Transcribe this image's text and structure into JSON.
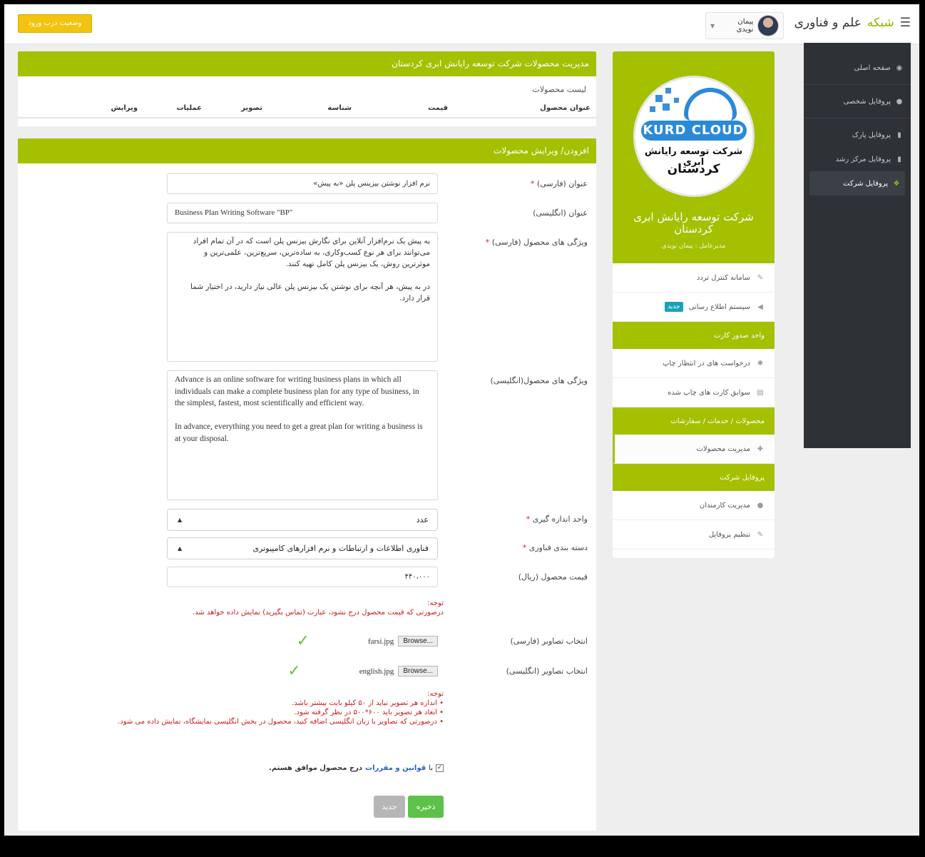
{
  "topbar": {
    "brand_prefix": "شبکه",
    "brand_suffix": "علم و فناوری",
    "user_name": "پیمان نویدی",
    "door_button": "وضعیت درب ورود"
  },
  "dark_sidebar": {
    "items": [
      {
        "label": "صفحه اصلی",
        "icon": "dashboard-icon"
      },
      {
        "label": "پروفایل شخصی",
        "icon": "user-icon"
      },
      {
        "label": "پروفایل پارک",
        "icon": "building-icon"
      },
      {
        "label": "پروفایل مرکز رشد",
        "icon": "building-icon"
      },
      {
        "label": "پروفایل شرکت",
        "icon": "cubes-icon"
      }
    ]
  },
  "profile": {
    "logo_word": "KURD CLOUD",
    "logo_fa_line1": "شرکت توسعه رایانش ابری",
    "logo_fa_line2": "کردستان",
    "company_name": "شرکت توسعه رایانش ابری کردستان",
    "ceo": "مدیرعامل : پیمان نویدی",
    "rows": {
      "access": "سامانه کنترل تردد",
      "notify": "سیستم اطلاع رسانی",
      "notify_badge": "جدید",
      "section_card": "واحد صدور کارت",
      "print_requests": "درخواست های در انتظار چاپ",
      "printed_cards": "سوابق کارت های چاپ شده",
      "section_products": "محصولات / خدمات / سفارشات",
      "manage_products": "مدیریت محصولات",
      "section_company": "پروفایل شرکت",
      "manage_employees": "مدیریت کارمندان",
      "profile_settings": "تنظیم پروفایل"
    }
  },
  "list_panel": {
    "title": "مدیریت محصولات شرکت توسعه رایانش ابری کردستان",
    "subtitle": "لیست محصولات",
    "columns": [
      "عنوان محصول",
      "قیمت",
      "شناسه",
      "تصویر",
      "عملیات",
      "ویرایش"
    ]
  },
  "form": {
    "title": "افزودن/ ویرایش محصولات",
    "title_fa_label": "عنوان (فارسی)",
    "title_fa_value": "نرم افزار نوشتن بیزینس پلن «به پیش»",
    "title_en_label": "عنوان (انگلیسی)",
    "title_en_value": "Business Plan Writing Software \"BP\"",
    "features_fa_label": "ویژگی های محصول (فارسی)",
    "features_fa_value": "به پیش یک نرم‌افزار آنلاین برای نگارش بیزنس پلن است که در آن تمام افراد می‌توانند برای هر نوع کسب‌وکاری، به ساده‌ترین، سریع‌ترین، علمی‌ترین و موثرترین روش، یک بیزنس پلن کامل تهیه کنند.\n\nدر به پیش، هر آنچه برای نوشتن یک بیزنس پلن عالی نیاز دارید، در اختیار شما قرار دارد.",
    "features_en_label": "ویژگی های محصول(انگلیسی)",
    "features_en_value": "Advance is an online software for writing business plans in which all individuals can make a complete business plan for any type of business, in the simplest, fastest, most scientifically and efficient way.\n\nIn advance, everything you need to get a great plan for writing a business is at your disposal.",
    "unit_label": "واحد اندازه گیری",
    "unit_value": "عدد",
    "category_label": "دسته بندی فناوری",
    "category_value": "فناوری اطلاعات و ارتباطات و نرم افزارهای کامپیوتری",
    "price_label": "قیمت محصول (ریال)",
    "price_value": "۴۴۰،۰۰۰",
    "note1_title": "توجه:",
    "note1_text": "درصورتی که قیمت محصول درج نشود، عبارت (تماس بگیرید) نمایش داده خواهد شد.",
    "image_fa_label": "انتخاب تصاویر (فارسی)",
    "image_fa_file": "farsi.jpg",
    "image_en_label": "انتخاب تصاویر (انگلیسی)",
    "image_en_file": "english.jpg",
    "browse": "Browse...",
    "note2_title": "توجه:",
    "note2_lines": [
      "• اندازه هر تصویر نباید از ۵۰ کیلو بایت بیشتر باشد.",
      "• ابعاد هر تصویر باید ۶۰۰*۵۰۰ در نظر گرفته شود.",
      "• درصورتی که تصاویر با زبان انگلیسی اضافه کنید، محصول در بخش انگلیسی نمایشگاه، نمایش داده می شود."
    ],
    "agree_pre": "با",
    "agree_link": "قوانین و مقررات",
    "agree_post": "درج محصول موافق هستم.",
    "save": "ذخیره",
    "new": "جدید"
  },
  "colors": {
    "accent": "#a5c000",
    "sidebar_dark": "#2e3136",
    "warning": "#f2c40f",
    "save": "#5cc24a",
    "error": "#c81d1d"
  }
}
